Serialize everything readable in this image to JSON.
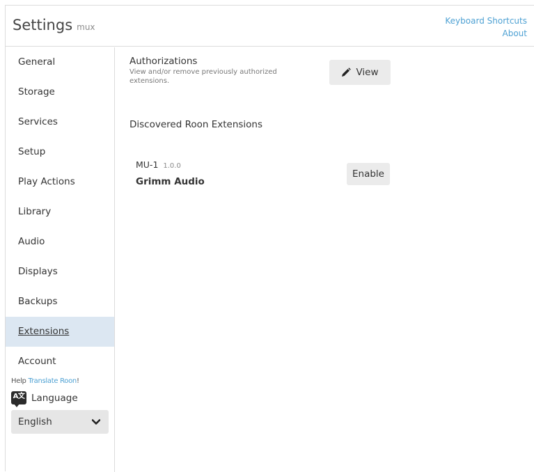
{
  "header": {
    "title": "Settings",
    "subtitle": "mux",
    "links": [
      "Keyboard Shortcuts",
      "About"
    ]
  },
  "sidebar": {
    "items": [
      {
        "label": "General",
        "active": false
      },
      {
        "label": "Storage",
        "active": false
      },
      {
        "label": "Services",
        "active": false
      },
      {
        "label": "Setup",
        "active": false
      },
      {
        "label": "Play Actions",
        "active": false
      },
      {
        "label": "Library",
        "active": false
      },
      {
        "label": "Audio",
        "active": false
      },
      {
        "label": "Displays",
        "active": false
      },
      {
        "label": "Backups",
        "active": false
      },
      {
        "label": "Extensions",
        "active": true
      },
      {
        "label": "Account",
        "active": false
      }
    ],
    "help_prefix": "Help ",
    "help_link": "Translate Roon",
    "help_suffix": "!",
    "language_icon_text": "A文",
    "language_label": "Language",
    "language_value": "English"
  },
  "main": {
    "authorizations": {
      "title": "Authorizations",
      "description": "View and/or remove previously authorized extensions.",
      "button_label": "View"
    },
    "discovered_title": "Discovered Roon Extensions",
    "extension": {
      "name": "MU-1",
      "version": "1.0.0",
      "author": "Grimm Audio",
      "button_label": "Enable"
    }
  },
  "colors": {
    "accent_link": "#4ea1d3",
    "active_item_bg": "#dce7f2",
    "button_bg": "#ebebeb"
  }
}
